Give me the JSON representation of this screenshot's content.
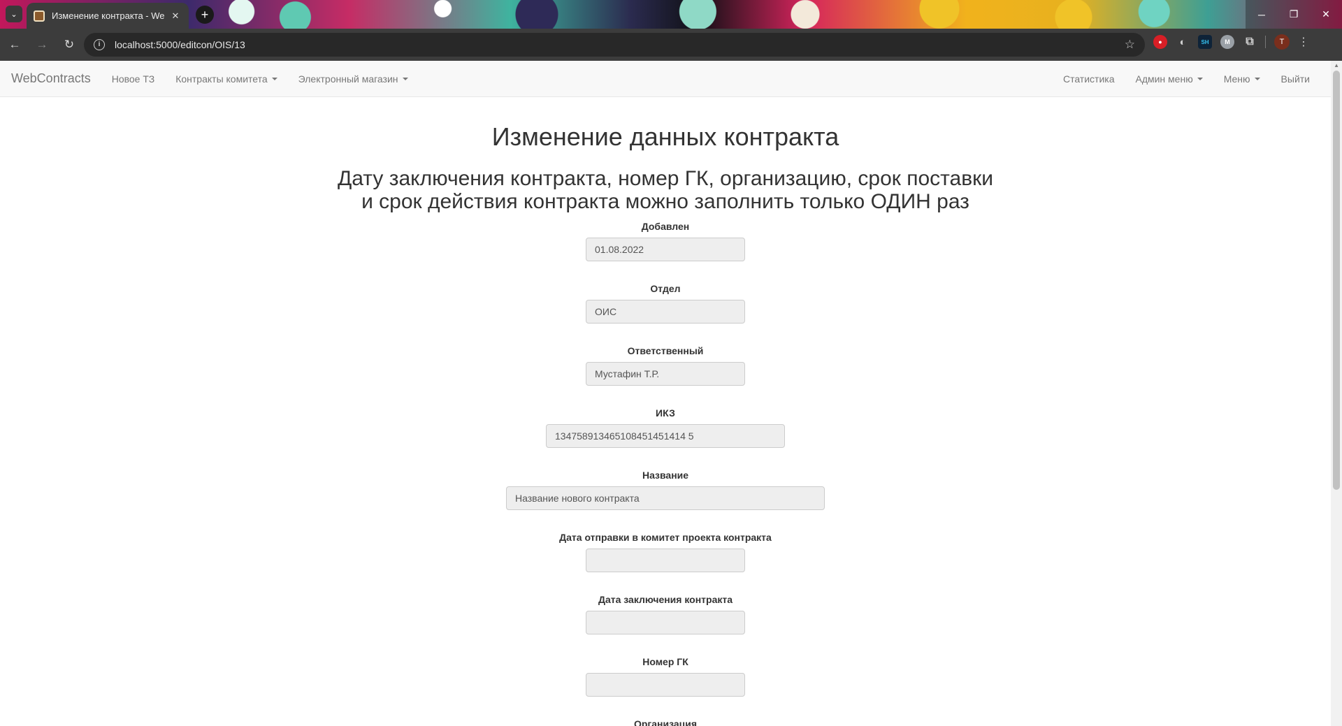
{
  "browser": {
    "tab_title": "Изменение контракта - WebC",
    "tab_close": "✕",
    "new_tab": "+",
    "url": "localhost:5000/editcon/OIS/13",
    "ext_sh": "SH",
    "ext_m": "M",
    "profile_initial": "T",
    "window_controls": {
      "minimize": "─",
      "restore": "❐",
      "close": "✕"
    }
  },
  "navbar": {
    "brand": "WebContracts",
    "left_links": [
      "Новое ТЗ",
      "Контракты комитета",
      "Электронный магазин"
    ],
    "right_links": [
      "Статистика",
      "Админ меню",
      "Меню",
      "Выйти"
    ]
  },
  "page": {
    "title": "Изменение данных контракта",
    "subtitle_line1": "Дату заключения контракта, номер ГК, организацию, срок поставки",
    "subtitle_line2": "и срок действия контракта можно заполнить только ОДИН раз"
  },
  "fields": [
    {
      "label": "Добавлен",
      "value": "01.08.2022"
    },
    {
      "label": "Отдел",
      "value": "ОИС"
    },
    {
      "label": "Ответственный",
      "value": "Мустафин Т.Р."
    },
    {
      "label": "ИКЗ",
      "value": "134758913465108451451414 5"
    },
    {
      "label": "Название",
      "value": "Название нового контракта"
    },
    {
      "label": "Дата отправки в комитет проекта контракта",
      "value": ""
    },
    {
      "label": "Дата заключения контракта",
      "value": ""
    },
    {
      "label": "Номер ГК",
      "value": ""
    },
    {
      "label": "Организация",
      "value": ""
    }
  ]
}
